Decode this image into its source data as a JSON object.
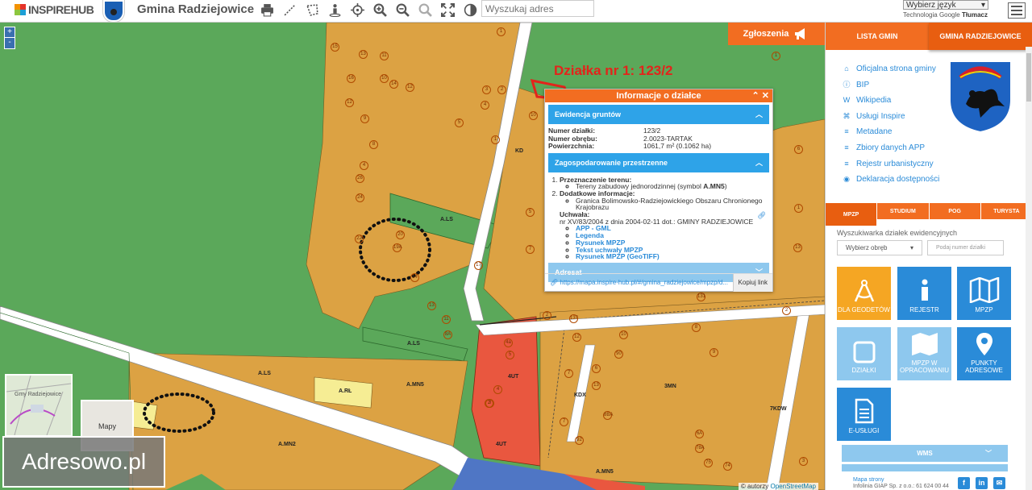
{
  "header": {
    "logo_text": "INSPIREHUB",
    "municipality": "Gmina Radziejowice",
    "search_placeholder": "Wyszukaj adres",
    "language_select": "Wybierz język",
    "translate_label": "Technologia",
    "translate_brand_google": "Google",
    "translate_brand_tlumacz": "Tłumacz",
    "tools": [
      "print-icon",
      "measure-line-icon",
      "measure-area-icon",
      "streetview-icon",
      "locate-icon",
      "zoom-in-icon",
      "zoom-out-icon",
      "zoom-extent-icon",
      "fullscreen-icon",
      "contrast-icon"
    ]
  },
  "map": {
    "zoom_in": "+",
    "zoom_out": "-",
    "selected_plot_title": "Działka nr 1: 123/2",
    "report_button": "Zgłoszenia",
    "thumbnail_1_label": "Gmy Radziejowice",
    "thumbnail_2_label": "Mapy",
    "watermark": "Adresowo.pl",
    "attribution_prefix": "© autorzy",
    "attribution_link": "OpenStreetMap",
    "zone_labels": [
      "A.LS",
      "A.LS",
      "A.LS",
      "A.RŁ",
      "A.MN5",
      "A.MN2",
      "4UT",
      "KDX",
      "3MN",
      "7KDW",
      "KD",
      "A.MN5",
      "4UT"
    ],
    "parcel_numbers": [
      "15",
      "13",
      "11",
      "16",
      "10",
      "14",
      "12",
      "12",
      "9",
      "3",
      "5",
      "4",
      "2",
      "1",
      "1",
      "8",
      "4",
      "26",
      "24",
      "22",
      "20",
      "19A",
      "17",
      "14",
      "13",
      "11",
      "10",
      "5",
      "7",
      "8A",
      "1",
      "6",
      "1",
      "13",
      "4a",
      "5",
      "4",
      "3",
      "2",
      "137",
      "12",
      "90",
      "10",
      "8",
      "7",
      "6",
      "9",
      "13",
      "8BA",
      "7",
      "92",
      "78A",
      "6A",
      "75",
      "74",
      "3",
      "131",
      "2",
      "2"
    ]
  },
  "popup": {
    "title": "Informacje o działce",
    "section_ewidencja": "Ewidencja gruntów",
    "fields": [
      {
        "label": "Numer działki:",
        "value": "123/2"
      },
      {
        "label": "Numer obrębu:",
        "value": "2.0023-TARTAK"
      },
      {
        "label": "Powierzchnia:",
        "value": "1061,7 m² (0.1062 ha)"
      }
    ],
    "section_zagosp": "Zagospodarowanie przestrzenne",
    "item1_title": "Przeznaczenie terenu:",
    "item1_bullet_prefix": "Tereny zabudowy jednorodzinnej (symbol ",
    "item1_bullet_symbol": "A.MN5",
    "item1_bullet_suffix": ")",
    "item2_title": "Dodatkowe informacje:",
    "item2_bullet": "Granica Bolimowsko-Radziejowickiego Obszaru Chronionego Krajobrazu",
    "uchwala_label": "Uchwała:",
    "uchwala_text": "nr XV/83/2004 z dnia 2004-02-11 dot.: GMINY RADZIEJOWICE",
    "links": [
      "APP - GML",
      "Legenda",
      "Rysunek MPZP",
      "Tekst uchwały MPZP",
      "Rysunek MPZP (GeoTIFF)"
    ],
    "section_adresat": "Adresat",
    "url": "https://mapa.inspire-hub.pl/#/gmina_radziejowice/mpzp/d...",
    "copy_button": "Kopiuj link"
  },
  "sidebar": {
    "tab_lista": "LISTA GMIN",
    "tab_gmina": "GMINA RADZIEJOWICE",
    "links": [
      {
        "icon": "home-icon",
        "label": "Oficjalna strona gminy"
      },
      {
        "icon": "info-icon",
        "label": "BIP"
      },
      {
        "icon": "wikipedia-icon",
        "label": "Wikipedia"
      },
      {
        "icon": "building-icon",
        "label": "Usługi Inspire"
      },
      {
        "icon": "database-icon",
        "label": "Metadane"
      },
      {
        "icon": "database-icon",
        "label": "Zbiory danych APP"
      },
      {
        "icon": "database-icon",
        "label": "Rejestr urbanistyczny"
      },
      {
        "icon": "eye-icon",
        "label": "Deklaracja dostępności"
      }
    ],
    "subtabs": [
      "MPZP",
      "STUDIUM",
      "POG",
      "TURYSTA"
    ],
    "search_label": "Wyszukiwarka działek ewidencyjnych",
    "select_placeholder": "Wybierz obręb",
    "input_placeholder": "Podaj numer działki",
    "tiles": [
      {
        "label": "DLA GEODETÓW",
        "color": "#f5a623"
      },
      {
        "label": "REJESTR",
        "color": "#2a8bd8"
      },
      {
        "label": "MPZP",
        "color": "#2a8bd8"
      },
      {
        "label": "DZIAŁKI",
        "color": "#8ec8ee"
      },
      {
        "label": "MPZP W OPRACOWANIU",
        "color": "#8ec8ee"
      },
      {
        "label": "PUNKTY ADRESOWE",
        "color": "#2a8bd8"
      },
      {
        "label": "E-USŁUGI",
        "color": "#2a8bd8"
      }
    ],
    "wms_label": "WMS",
    "footer_link": "Mapa strony",
    "footer_company": "Infolinia GIAP Sp. z o.o.: 61 624 00 44",
    "social": [
      "f",
      "in",
      "✉"
    ]
  }
}
